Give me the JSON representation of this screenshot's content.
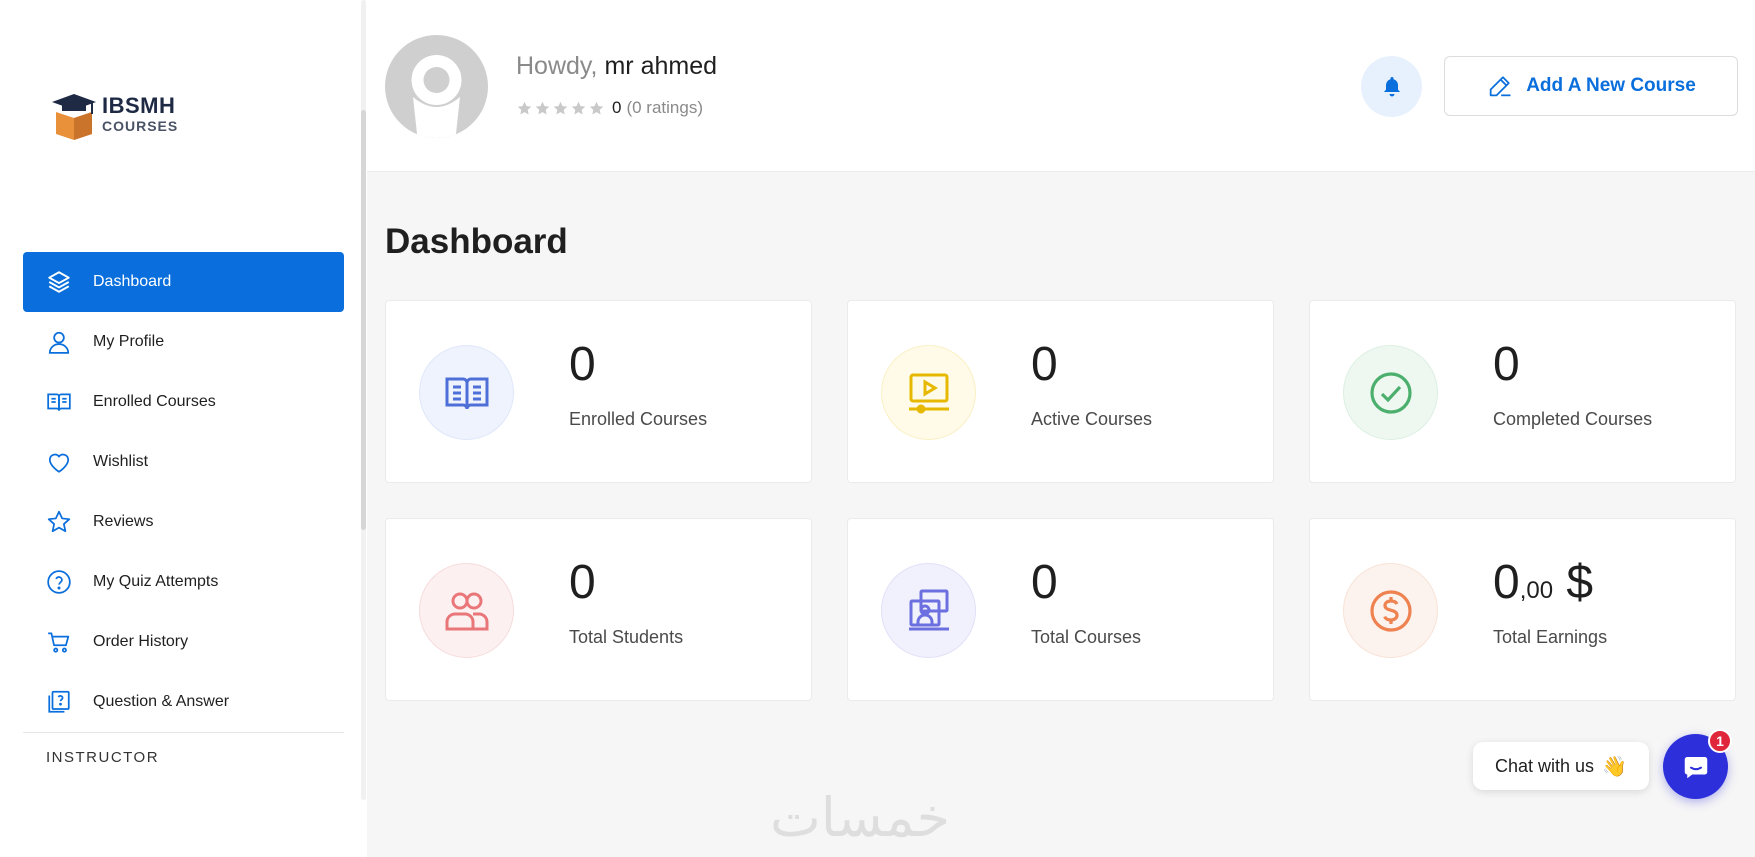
{
  "sidebar": {
    "logo": {
      "line1": "IBSMH",
      "line2": "COURSES"
    },
    "items": [
      {
        "label": "Dashboard",
        "icon": "layers-icon",
        "active": true
      },
      {
        "label": "My Profile",
        "icon": "user-icon"
      },
      {
        "label": "Enrolled Courses",
        "icon": "book-open-icon"
      },
      {
        "label": "Wishlist",
        "icon": "heart-icon"
      },
      {
        "label": "Reviews",
        "icon": "star-icon"
      },
      {
        "label": "My Quiz Attempts",
        "icon": "question-circle-icon"
      },
      {
        "label": "Order History",
        "icon": "cart-icon"
      },
      {
        "label": "Question & Answer",
        "icon": "qa-icon"
      }
    ],
    "section_label": "INSTRUCTOR"
  },
  "header": {
    "greeting": "Howdy,",
    "user_name": "mr ahmed",
    "rating_value": "0",
    "rating_count": "(0 ratings)",
    "stars_filled": 0,
    "add_course_label": "Add A New Course"
  },
  "main": {
    "title": "Dashboard",
    "cards": [
      {
        "value": "0",
        "label": "Enrolled Courses",
        "icon": "book-open-icon",
        "accent": "#4f6fd8",
        "bg": "#eef3fd"
      },
      {
        "value": "0",
        "label": "Active Courses",
        "icon": "video-icon",
        "accent": "#e6b800",
        "bg": "#fffbe8"
      },
      {
        "value": "0",
        "label": "Completed Courses",
        "icon": "check-circle-icon",
        "accent": "#4caf6d",
        "bg": "#eef8f1"
      },
      {
        "value": "0",
        "label": "Total Students",
        "icon": "users-icon",
        "accent": "#e9777a",
        "bg": "#fdf0f0"
      },
      {
        "value": "0",
        "label": "Total Courses",
        "icon": "presentation-icon",
        "accent": "#6c6fe0",
        "bg": "#f1f1fd"
      },
      {
        "value": "0",
        "value_decimal": ",00",
        "value_currency": "$",
        "label": "Total Earnings",
        "icon": "dollar-circle-icon",
        "accent": "#ee8250",
        "bg": "#fdf3ee"
      }
    ]
  },
  "chat": {
    "label": "Chat with us",
    "wave": "👋",
    "badge": "1"
  },
  "watermark": "خمسات",
  "colors": {
    "primary": "#0a6fdc",
    "chat": "#2d2fdb",
    "badge": "#e0263a"
  }
}
